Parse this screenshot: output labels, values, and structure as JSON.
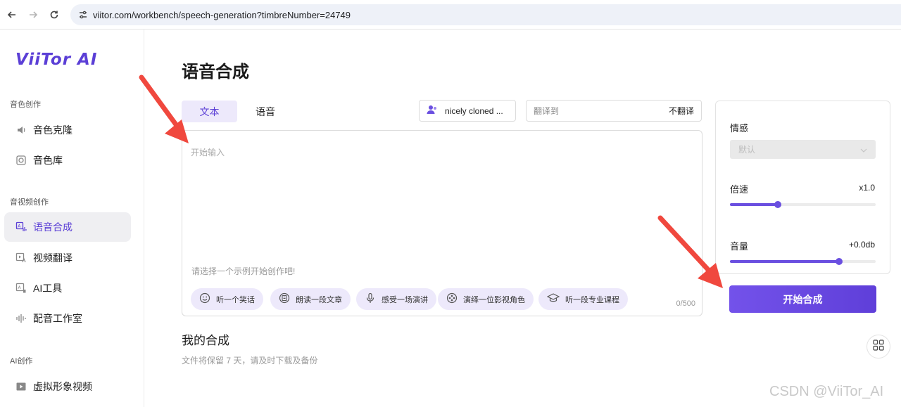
{
  "browser": {
    "url": "viitor.com/workbench/speech-generation?timbreNumber=24749"
  },
  "sidebar": {
    "logo": "ViiTor AI",
    "sections": [
      {
        "label": "音色创作",
        "items": [
          {
            "label": "音色克隆",
            "icon": "speaker-icon"
          },
          {
            "label": "音色库",
            "icon": "disc-icon"
          }
        ]
      },
      {
        "label": "音视频创作",
        "items": [
          {
            "label": "语音合成",
            "icon": "text-speech-icon",
            "active": true
          },
          {
            "label": "视频翻译",
            "icon": "video-translate-icon"
          },
          {
            "label": "AI工具",
            "icon": "ai-tool-icon"
          },
          {
            "label": "配音工作室",
            "icon": "waveform-icon"
          }
        ]
      },
      {
        "label": "AI创作",
        "items": [
          {
            "label": "虚拟形象视频",
            "icon": "play-video-icon"
          }
        ]
      }
    ]
  },
  "main": {
    "title": "语音合成",
    "tabs": [
      {
        "label": "文本",
        "active": true
      },
      {
        "label": "语音",
        "active": false
      }
    ],
    "voice_select": "nicely cloned ...",
    "translate": {
      "placeholder": "翻译到",
      "value": "不翻译"
    },
    "editor": {
      "placeholder": "开始输入",
      "value": "",
      "hint": "请选择一个示例开始创作吧!",
      "char_count": "0/500"
    },
    "examples": [
      {
        "label": "听一个笑话",
        "icon": "smile-icon"
      },
      {
        "label": "朗读一段文章",
        "icon": "book-icon"
      },
      {
        "label": "感受一场演讲",
        "icon": "microphone-icon"
      },
      {
        "label": "演绎一位影视角色",
        "icon": "film-reel-icon"
      },
      {
        "label": "听一段专业课程",
        "icon": "graduation-cap-icon"
      }
    ],
    "my_synthesis": {
      "title": "我的合成",
      "subtitle": "文件将保留 7 天，请及时下载及备份"
    }
  },
  "panel": {
    "emotion": {
      "label": "情感",
      "value": "默认"
    },
    "speed": {
      "label": "倍速",
      "value": "x1.0",
      "level": 0.33
    },
    "volume": {
      "label": "音量",
      "value": "+0.0db",
      "level": 0.75
    },
    "start_label": "开始合成"
  },
  "watermark": "CSDN @ViiTor_AI",
  "colors": {
    "accent": "#6a4fe0",
    "arrow": "#f0483e"
  }
}
